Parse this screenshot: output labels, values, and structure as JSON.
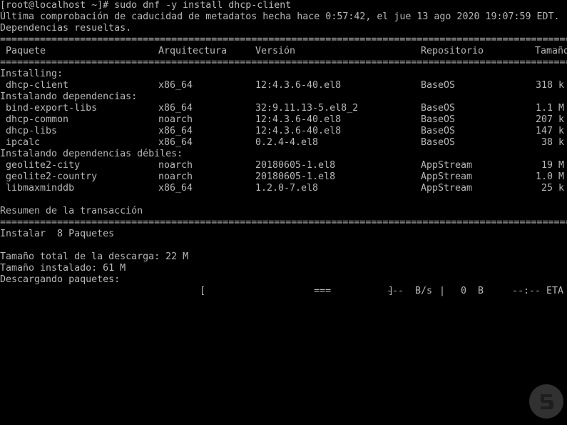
{
  "terminal": {
    "prompt": "[root@localhost ~]# sudo dnf -y install dhcp-client",
    "metadata": "Última comprobación de caducidad de metadatos hecha hace 0:57:42, el jue 13 ago 2020 19:07:59 EDT.",
    "resolved": "Dependencias resueltas.",
    "separator": "==================================================================================================================================",
    "headers": {
      "package": " Paquete",
      "arch": "Arquitectura",
      "version": "Versión",
      "repo": "Repositorio",
      "size": "Tamaño"
    },
    "section_installing": "Installing:",
    "section_deps": "Instalando dependencias:",
    "section_weak": "Instalando dependencias débiles:",
    "packages": [
      {
        "name": " dhcp-client",
        "arch": "x86_64",
        "version": "12:4.3.6-40.el8",
        "repo": "BaseOS",
        "size": "318 k"
      },
      {
        "name": " bind-export-libs",
        "arch": "x86_64",
        "version": "32:9.11.13-5.el8_2",
        "repo": "BaseOS",
        "size": "1.1 M"
      },
      {
        "name": " dhcp-common",
        "arch": "noarch",
        "version": "12:4.3.6-40.el8",
        "repo": "BaseOS",
        "size": "207 k"
      },
      {
        "name": " dhcp-libs",
        "arch": "x86_64",
        "version": "12:4.3.6-40.el8",
        "repo": "BaseOS",
        "size": "147 k"
      },
      {
        "name": " ipcalc",
        "arch": "x86_64",
        "version": "0.2.4-4.el8",
        "repo": "BaseOS",
        "size": "38 k"
      },
      {
        "name": " geolite2-city",
        "arch": "noarch",
        "version": "20180605-1.el8",
        "repo": "AppStream",
        "size": "19 M"
      },
      {
        "name": " geolite2-country",
        "arch": "noarch",
        "version": "20180605-1.el8",
        "repo": "AppStream",
        "size": "1.0 M"
      },
      {
        "name": " libmaxminddb",
        "arch": "x86_64",
        "version": "1.2.0-7.el8",
        "repo": "AppStream",
        "size": "25 k"
      }
    ],
    "summary_title": "Resumen de la transacción",
    "install_count": "Instalar  8 Paquetes",
    "total_download": "Tamaño total de la descarga: 22 M",
    "installed_size": "Tamaño instalado: 61 M",
    "downloading": "Descargando paquetes:",
    "progress": {
      "bar": "[                   ===          ]",
      "rate_label": "---  B/s",
      "pipe": "|",
      "bytes": "0  B",
      "eta": "--:-- ETA"
    }
  },
  "colors": {
    "background": "#000000",
    "text": "#b8b8b8"
  },
  "logo": {
    "icon": "watermark-logo-icon"
  }
}
